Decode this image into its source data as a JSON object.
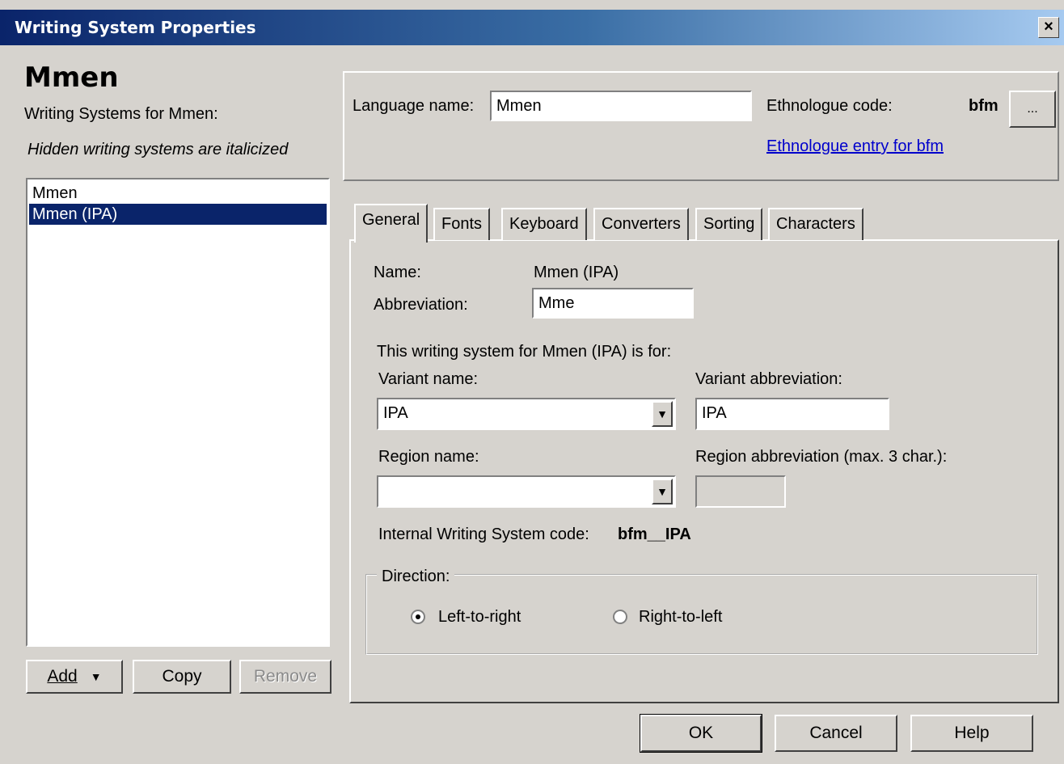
{
  "window": {
    "title": "Writing System Properties",
    "close_glyph": "×"
  },
  "left": {
    "heading": "Mmen",
    "subtitle": "Writing Systems for Mmen:",
    "hint": "Hidden writing systems are italicized",
    "items": [
      {
        "label": "Mmen",
        "selected": false
      },
      {
        "label": "Mmen (IPA)",
        "selected": true
      }
    ],
    "buttons": {
      "add": "Add",
      "copy": "Copy",
      "remove": "Remove"
    }
  },
  "language": {
    "name_label": "Language name:",
    "name_value": "Mmen",
    "code_label": "Ethnologue code:",
    "code_value": "bfm",
    "browse_label": "...",
    "link": "Ethnologue entry for bfm"
  },
  "tabs": [
    "General",
    "Fonts",
    "Keyboard",
    "Converters",
    "Sorting",
    "Characters"
  ],
  "general": {
    "name_label": "Name:",
    "name_value": "Mmen (IPA)",
    "abbrev_label": "Abbreviation:",
    "abbrev_value": "Mme",
    "for_text": "This writing system for Mmen (IPA) is for:",
    "variant_label": "Variant name:",
    "variant_value": "IPA",
    "variant_abbrev_label": "Variant abbreviation:",
    "variant_abbrev_value": "IPA",
    "region_label": "Region name:",
    "region_value": "",
    "region_abbrev_label": "Region abbreviation (max. 3 char.):",
    "region_abbrev_value": "",
    "internal_label": "Internal Writing System code:",
    "internal_value": "bfm__IPA",
    "direction_label": "Direction:",
    "ltr_label": "Left-to-right",
    "rtl_label": "Right-to-left"
  },
  "footer": {
    "ok": "OK",
    "cancel": "Cancel",
    "help": "Help"
  },
  "icons": {
    "dropdown": "▼"
  }
}
